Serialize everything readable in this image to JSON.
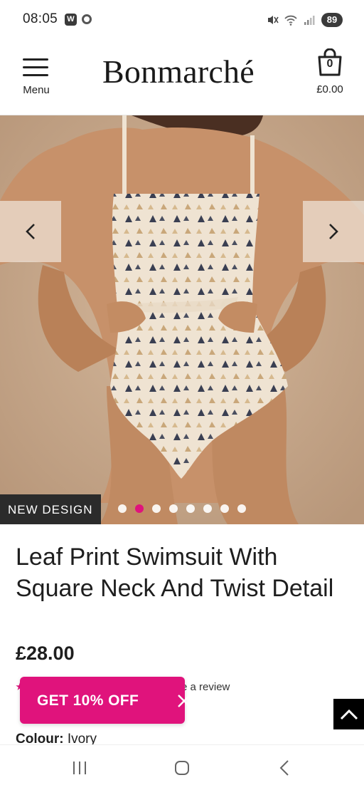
{
  "status_bar": {
    "time": "08:05",
    "app_badge": "W",
    "battery": "89",
    "icons": [
      "whatsapp-icon",
      "chrome-icon",
      "mute-icon",
      "wifi-icon",
      "signal-icon",
      "battery-icon"
    ]
  },
  "header": {
    "menu_label": "Menu",
    "logo": "Bonmarché",
    "bag_count": "0",
    "bag_total": "£0.00",
    "brand_color": "#e0137c"
  },
  "gallery": {
    "badge": "NEW DESIGN",
    "slide_count": 8,
    "active_slide": 2,
    "prev_icon": "chevron-left-icon",
    "next_icon": "chevron-right-icon"
  },
  "product": {
    "title": "Leaf Print Swimsuit With Square Neck And Twist Detail",
    "price": "£28.00",
    "review_link": "e a review",
    "colour_label": "Colour:",
    "colour_value": "Ivory"
  },
  "promo": {
    "label": "GET 10% OFF",
    "close_icon": "close-icon",
    "color": "#e0137c"
  },
  "back_to_top": {
    "icon": "chevron-up-icon"
  },
  "nav_bar": {
    "icons": [
      "recents-icon",
      "home-icon",
      "back-icon"
    ]
  }
}
